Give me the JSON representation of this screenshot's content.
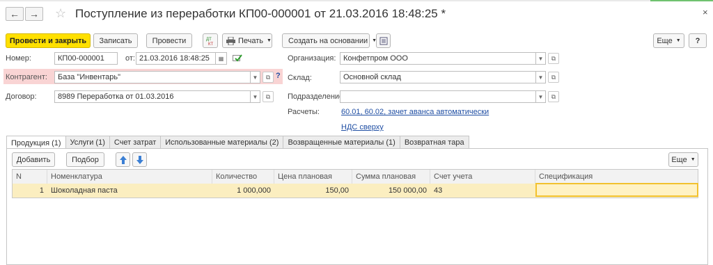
{
  "window": {
    "title": "Поступление из переработки КП00-000001 от 21.03.2016 18:48:25 *",
    "back_icon": "←",
    "forward_icon": "→",
    "star_icon": "☆",
    "close_icon": "×"
  },
  "toolbar": {
    "post_close": "Провести и закрыть",
    "save": "Записать",
    "post": "Провести",
    "dt_kt": "Дт Кт",
    "print": "Печать",
    "create_based": "Создать на основании",
    "more": "Еще",
    "help": "?"
  },
  "form": {
    "number_label": "Номер:",
    "number_value": "КП00-000001",
    "date_label": "от:",
    "date_value": "21.03.2016 18:48:25",
    "counterparty_label": "Контрагент:",
    "counterparty_value": "База \"Инвентарь\"",
    "contract_label": "Договор:",
    "contract_value": "8989 Переработка от 01.03.2016",
    "organization_label": "Организация:",
    "organization_value": "Конфетпром ООО",
    "warehouse_label": "Склад:",
    "warehouse_value": "Основной склад",
    "department_label": "Подразделение:",
    "department_value": "",
    "settlements_label": "Расчеты:",
    "settlements_link": "60.01, 60.02, зачет аванса автоматически",
    "vat_link": "НДС сверху",
    "question_mark": "?"
  },
  "tabs": [
    "Продукция (1)",
    "Услуги (1)",
    "Счет затрат",
    "Использованные материалы (2)",
    "Возвращенные материалы (1)",
    "Возвратная тара"
  ],
  "table_toolbar": {
    "add": "Добавить",
    "select": "Подбор",
    "more": "Еще"
  },
  "table": {
    "columns": [
      "N",
      "Номенклатура",
      "Количество",
      "Цена плановая",
      "Сумма плановая",
      "Счет учета",
      "Спецификация"
    ],
    "rows": [
      {
        "n": "1",
        "item": "Шоколадная паста",
        "qty": "1 000,000",
        "price": "150,00",
        "sum": "150 000,00",
        "account": "43",
        "spec": ""
      }
    ]
  },
  "colors": {
    "accent_yellow": "#ffe000",
    "highlight_row": "#fbeec0",
    "error_field": "#f9d4d4",
    "link": "#1f4ea3"
  }
}
